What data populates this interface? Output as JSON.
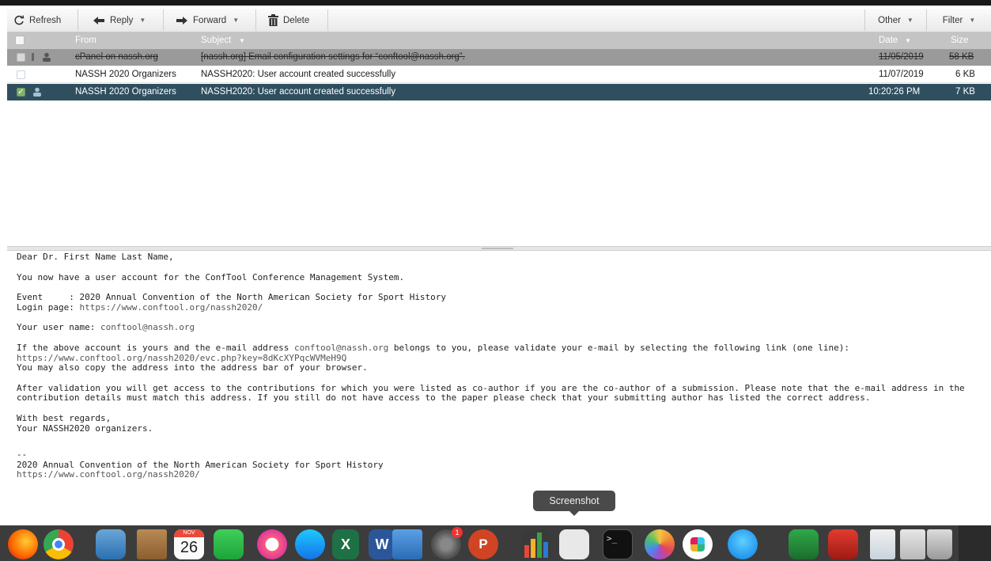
{
  "toolbar": {
    "refresh": "Refresh",
    "reply": "Reply",
    "forward": "Forward",
    "delete": "Delete",
    "other": "Other",
    "filter": "Filter"
  },
  "list": {
    "columns": {
      "from": "From",
      "subject": "Subject",
      "date": "Date",
      "size": "Size"
    },
    "rows": [
      {
        "from": "cPanel on nassh.org",
        "subject": "[nassh.org] Email configuration settings for “conftool@nassh.org”.",
        "date": "11/05/2019",
        "size": "58 KB",
        "state": "deleted"
      },
      {
        "from": "NASSH 2020 Organizers",
        "subject": "NASSH2020: User account created successfully",
        "date": "11/07/2019",
        "size": "6 KB",
        "state": "normal"
      },
      {
        "from": "NASSH 2020 Organizers",
        "subject": "NASSH2020: User account created successfully",
        "date": "10:20:26 PM",
        "size": "7 KB",
        "state": "selected"
      }
    ]
  },
  "message": {
    "greeting": "Dear Dr. First Name Last Name,",
    "p1": "You now have a user account for the ConfTool Conference Management System.",
    "event_line": "Event     : 2020 Annual Convention of the North American Society for Sport History",
    "login_label": "Login page: ",
    "login_url": "https://www.conftool.org/nassh2020/",
    "username_label": "Your user name: ",
    "username": "conftool@nassh.org",
    "p3_a": "If the above account is yours and the e-mail address ",
    "p3_email": "conftool@nassh.org",
    "p3_b": " belongs to you, please validate your e-mail by selecting the following link (one line):",
    "validate_url": "https://www.conftool.org/nassh2020/evc.php?key=8dKcXYPqcWVMeH9Q",
    "p3_c": "You may also copy the address into the address bar of your browser.",
    "p4": "After validation you will get access to the contributions for which you were listed as co-author if you are the co-author of a submission. Please note that the e-mail address in the contribution details must match this address. If you still do not have access to the paper please check that your submitting author has listed the correct address.",
    "closing1": "With best regards,",
    "closing2": "Your NASSH2020 organizers.",
    "sig_sep": "--",
    "sig_line": "2020 Annual Convention of the North American Society for Sport History",
    "sig_url": "https://www.conftool.org/nassh2020/"
  },
  "tooltip": "Screenshot",
  "dock": {
    "calendar_day": "26",
    "calendar_month": "NOV",
    "sysprefs_badge": "1",
    "icons": [
      "firefox-icon",
      "chrome-icon",
      "preview-icon",
      "notes-folder-icon",
      "calendar-icon",
      "facetime-icon",
      "itunes-icon",
      "app-store-icon",
      "excel-icon",
      "word-icon",
      "keynote-icon",
      "system-preferences-icon",
      "powerpoint-icon",
      "numbers-icon",
      "screenshot-icon",
      "terminal-icon",
      "photos-icon",
      "slack-icon",
      "messages-icon",
      "elf-app-icon",
      "photo-booth-icon",
      "files-icon",
      "documents-icon",
      "trash-icon"
    ]
  }
}
